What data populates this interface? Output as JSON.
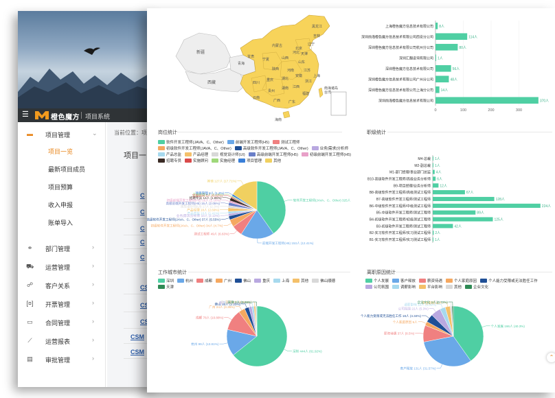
{
  "app": {
    "brand": "橙色魔方",
    "system_name": "项目系统",
    "breadcrumb": "当前位置：项",
    "page_title": "项目一"
  },
  "sidebar": {
    "groups": [
      {
        "label": "项目管理",
        "icon": "folder-icon",
        "expanded": true
      },
      {
        "label": "部门管理",
        "icon": "org-icon"
      },
      {
        "label": "运营管理",
        "icon": "truck-icon"
      },
      {
        "label": "客户关系",
        "icon": "handshake-icon"
      },
      {
        "label": "开票管理",
        "icon": "invoice-icon"
      },
      {
        "label": "合同管理",
        "icon": "contract-icon"
      },
      {
        "label": "运营报表",
        "icon": "chart-line-icon"
      },
      {
        "label": "审批管理",
        "icon": "approval-icon"
      }
    ],
    "sub_items": [
      "项目一览",
      "最新项目成员",
      "项目预算",
      "收入申报",
      "账单导入"
    ]
  },
  "back_list": {
    "links": [
      "C",
      "C",
      "C",
      "C",
      "C",
      "CS",
      "CS",
      "CS",
      "CSM",
      "CSM"
    ]
  },
  "map": {
    "regions": [
      "新疆",
      "西藏",
      "青海",
      "甘肃",
      "内蒙古",
      "四川",
      "云南",
      "黑龙江",
      "吉林",
      "辽宁",
      "山东",
      "江苏",
      "浙江",
      "湖北",
      "湖南",
      "广西",
      "广东",
      "福建",
      "河南",
      "河北",
      "山西",
      "陕西",
      "安徽",
      "江西",
      "贵州",
      "重庆",
      "宁夏",
      "北京",
      "天津",
      "上海",
      "台湾",
      "海南"
    ],
    "inset_label": "南海诸岛"
  },
  "chart_company": {
    "type": "bar",
    "categories": [
      "上海橙色魔方信息技术有限公司",
      "深圳前海橙色魔方信息技术有限公司西安分公司",
      "深圳橙色魔方信息技术有限公司杭州分公司",
      "深圳汇翻咨询有限公司",
      "深圳橙色魔方信息技术有限公司",
      "深圳橙色魔方信息技术有限公司广州分公司",
      "深圳橙色魔方信息技术有限公司上海分公司",
      "深圳前海橙色魔方信息技术有限公司"
    ],
    "values": [
      8,
      114,
      80,
      1,
      56,
      48,
      14,
      370
    ],
    "data_labels": [
      "8人",
      "114人",
      "80人",
      "1人",
      "56人",
      "48人",
      "14人",
      "370人"
    ],
    "xticks": [
      "0",
      "100",
      "200",
      "300"
    ],
    "xlim": [
      0,
      400
    ]
  },
  "chart_post": {
    "type": "pie",
    "title": "岗位统计",
    "legend": [
      "软件开发工程师(JAVA、C、Other)",
      "前端开发工程师(H5)",
      "测试工程师",
      "初级软件开发工程师(JAVA、C、Other)",
      "高级软件开发工程师(JAVA、C、Other)",
      "业务|需求|分析师",
      "产品总监",
      "产品经理",
      "视觉设计师(UI)",
      "高级前端开发工程师(H5)",
      "初级前端开发工程师(H5)",
      "招聘专员",
      "实施顾问",
      "实施经理",
      "项目管理",
      "其他"
    ],
    "colors": [
      "#4fcfa3",
      "#6aa8e8",
      "#f08080",
      "#f5a860",
      "#1f4f96",
      "#b9a8e0",
      "#a7d9ee",
      "#f4c06a",
      "#d8d8d8",
      "#6a7fc8",
      "#e8a0c8",
      "#3a2a24",
      "#d94a4a",
      "#9fd87a",
      "#3a7fd8",
      "#f0d060"
    ],
    "values": [
      325,
      153,
      49,
      34,
      18,
      10,
      10,
      17,
      10,
      15,
      8,
      14,
      5,
      5,
      8,
      127
    ],
    "labels": [
      "软件开发工程师(JAVA、C、Other) 325人",
      "前端开发工程师(H5) 153人 (12.41%)",
      "测试工程师 49人 (6.63%)",
      "初级软件开发工程师(JAVA、C、Other) 34人 (4.7%)",
      "高级软件开发工程师(JAVA、C、Other) 37人 (5.55%)",
      "业务|需求|分析师 10人 (2.12%)",
      "产品总监 10人 (1.41%)",
      "产品经理 18人 (2.69%)",
      "视觉设计师(UI) 17人 (2.3%)",
      "高级前端开发工程师(H5) 15人 (2.05%)",
      "初级前端开发工程师(H5) 16人 (2.16%)",
      "招聘专员 14人 (1.85%)",
      "实施顾问 5人 (0.82%)",
      "实施经理 8人 (1.15%)",
      "项目管理 8人 (1.2%)",
      "其他 127人 (17.71%)"
    ]
  },
  "chart_level": {
    "type": "bar",
    "title": "职级统计",
    "categories": [
      "M4-总裁",
      "M2-副总裁",
      "M1-部门经理/事业部门总监",
      "B10-高级软件开发工程师/高级业务分析师",
      "B9-项目经理/业务分析师",
      "B8-高级软件开发工程师/高级测试工程师",
      "B7-高级软件开发工程师/测试工程师",
      "B6-中级软件开发工程师/中级测试工程师",
      "B5-中级软件开发工程师/测试工程师",
      "B4-初级软件开发工程师/初级测试工程师",
      "B3-初级软件开发工程师/测试工程师",
      "B2-实习软件开发工程师/实习测试工程师",
      "B1-实习软件开发工程师/实习测试工程师"
    ],
    "values": [
      1,
      1,
      4,
      6,
      12,
      67,
      128,
      224,
      89,
      125,
      42,
      2,
      1
    ],
    "data_labels": [
      "1人",
      "1人",
      "4人",
      "6人",
      "12人",
      "67人",
      "128人",
      "224人",
      "89人",
      "125人",
      "42人",
      "2人",
      "1人"
    ],
    "xlim": [
      0,
      240
    ]
  },
  "chart_city": {
    "type": "pie",
    "title": "工作城市统计",
    "legend": [
      "深圳",
      "杭州",
      "成都",
      "广州",
      "佛山",
      "重庆",
      "上海",
      "其他",
      "佛山顺德",
      "天津"
    ],
    "colors": [
      "#4fcfa3",
      "#6aa8e8",
      "#f08080",
      "#f5a860",
      "#1f4f96",
      "#b9a8e0",
      "#a7d9ee",
      "#f4c06a",
      "#d8d8d8",
      "#2f8a55"
    ],
    "values": [
      444,
      99,
      78,
      24,
      16,
      11,
      8,
      6,
      3,
      2
    ],
    "labels": [
      "深圳 444人 (61.92%)",
      "杭州 99人 (13.81%)",
      "成都 78人 (10.88%)",
      "广州 24人 (3.35%)",
      "佛山 16人 (2.23%)",
      "重庆 11人 (1.53%)",
      "上海 8人 (1.12%)",
      "其他 6人 (0.84%)",
      "佛山顺德 3人 (0.42%)",
      "天津 2人 (0.28%)"
    ]
  },
  "chart_leave": {
    "type": "pie",
    "title": "离职原因统计",
    "legend": [
      "个人发展",
      "客户释放",
      "薪资待遇",
      "个人家庭原因",
      "个人能力受限或无法胜任工作",
      "公司氛围",
      "调薪影响",
      "平台影响",
      "其他",
      "企业文化"
    ],
    "colors": [
      "#4fcfa3",
      "#6aa8e8",
      "#f08080",
      "#f5a860",
      "#1f4f96",
      "#b9a8e0",
      "#a7d9ee",
      "#f4c06a",
      "#d8d8d8",
      "#2f8a55"
    ],
    "values": [
      166,
      131,
      37,
      9,
      18,
      22,
      12,
      11,
      4,
      3
    ],
    "labels": [
      "个人发展 166人 (40.3%)",
      "客户释放 131人 (31.57%)",
      "薪资待遇 37人 (8.5%)",
      "个人家庭原因 9人",
      "个人能力受限或无法胜任工作 18人 (4.34%)",
      "公司氛围 22人 (5.3%)",
      "调薪影响 12人 (2.89%)",
      "平台影响 11人",
      "其他 4人",
      "企业文化 3人 (0.72%)"
    ]
  }
}
